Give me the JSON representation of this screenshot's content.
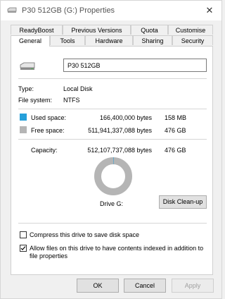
{
  "window": {
    "title": "P30 512GB (G:) Properties",
    "close_glyph": "✕"
  },
  "tabs_row1": [
    "ReadyBoost",
    "Previous Versions",
    "Quota",
    "Customise"
  ],
  "tabs_row2": [
    "General",
    "Tools",
    "Hardware",
    "Sharing",
    "Security"
  ],
  "active_tab": "General",
  "general": {
    "drive_name": "P30 512GB",
    "type_label": "Type:",
    "type_value": "Local Disk",
    "fs_label": "File system:",
    "fs_value": "NTFS",
    "used_label": "Used space:",
    "used_bytes": "166,400,000 bytes",
    "used_size": "158 MB",
    "free_label": "Free space:",
    "free_bytes": "511,941,337,088 bytes",
    "free_size": "476 GB",
    "capacity_label": "Capacity:",
    "capacity_bytes": "512,107,737,088 bytes",
    "capacity_size": "476 GB",
    "drive_label": "Drive G:",
    "cleanup_button": "Disk Clean-up",
    "compress_label": "Compress this drive to save disk space",
    "compress_checked": false,
    "index_label": "Allow files on this drive to have contents indexed in addition to file properties",
    "index_checked": true,
    "used_fraction": 0.000325
  },
  "colors": {
    "used": "#26a0da",
    "free": "#b5b5b5",
    "accent": "#0078d7"
  },
  "footer": {
    "ok": "OK",
    "cancel": "Cancel",
    "apply": "Apply",
    "apply_enabled": false
  }
}
